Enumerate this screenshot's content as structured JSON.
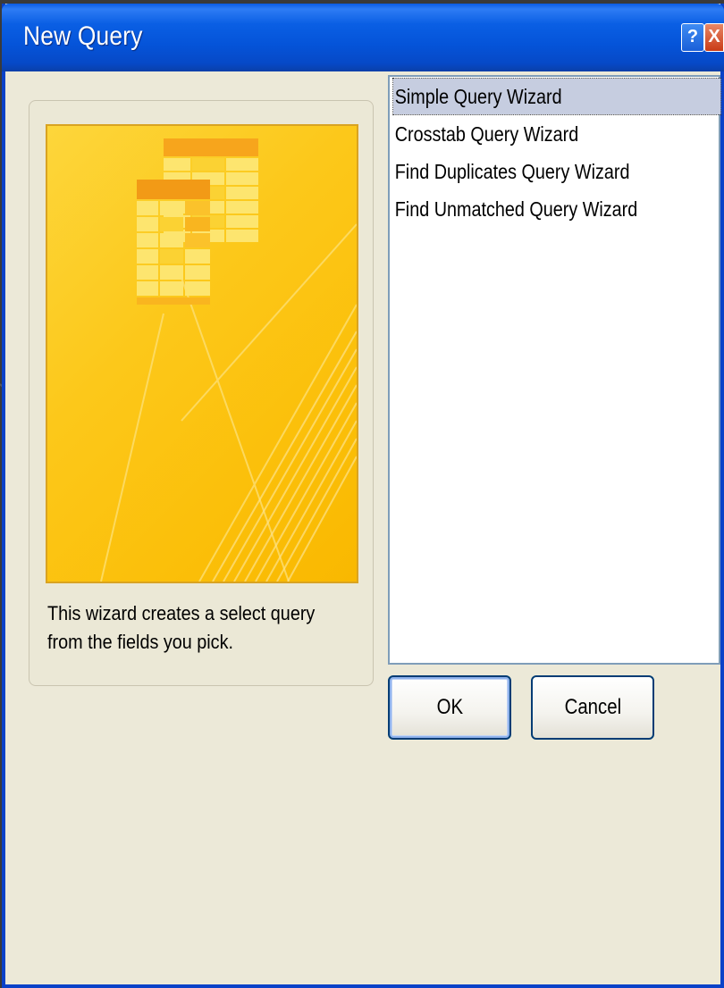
{
  "window": {
    "title": "New Query",
    "help_label": "?",
    "close_label": "X"
  },
  "description": "This wizard creates a select query from the fields you pick.",
  "query_list": {
    "items": [
      {
        "label": "Simple Query Wizard",
        "selected": true
      },
      {
        "label": "Crosstab Query Wizard",
        "selected": false
      },
      {
        "label": "Find Duplicates Query Wizard",
        "selected": false
      },
      {
        "label": "Find Unmatched Query Wizard",
        "selected": false
      }
    ]
  },
  "buttons": {
    "ok_label": "OK",
    "cancel_label": "Cancel"
  },
  "colors": {
    "titlebar": "#0554d9",
    "dialog_bg": "#ece9d8",
    "image_bg": "#fcc81a",
    "selection": "#c6cde0"
  },
  "icons": [
    "help-icon",
    "close-icon",
    "query-tables-illustration"
  ]
}
